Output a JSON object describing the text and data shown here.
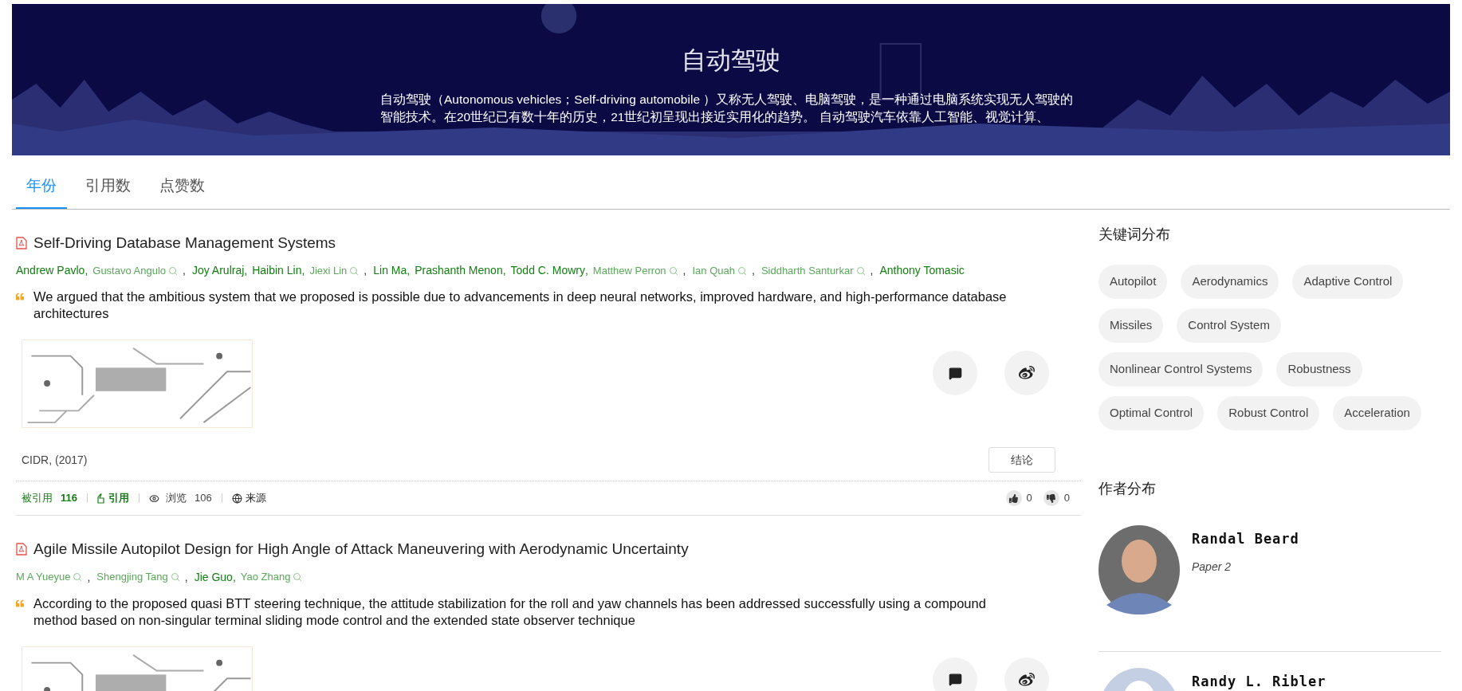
{
  "banner": {
    "title": "自动驾驶",
    "description": "自动驾驶（Autonomous vehicles；Self-driving automobile ）又称无人驾驶、电脑驾驶，是一种通过电脑系统实现无人驾驶的智能技术。在20世纪已有数十年的历史，21世纪初呈现出接近实用化的趋势。 自动驾驶汽车依靠人工智能、视觉计算、"
  },
  "tabs": [
    {
      "label": "年份",
      "selected": true
    },
    {
      "label": "引用数",
      "selected": false
    },
    {
      "label": "点赞数",
      "selected": false
    }
  ],
  "papers": [
    {
      "title": "Self-Driving Database Management Systems",
      "authors": [
        {
          "name": "Andrew Pavlo",
          "searchable": false,
          "separator": ","
        },
        {
          "name": "Gustavo Angulo",
          "searchable": true,
          "separator": ","
        },
        {
          "name": "Joy Arulraj",
          "searchable": false,
          "separator": ","
        },
        {
          "name": "Haibin Lin",
          "searchable": false,
          "separator": ","
        },
        {
          "name": "Jiexi Lin",
          "searchable": true,
          "separator": ","
        },
        {
          "name": "Lin Ma",
          "searchable": false,
          "separator": ","
        },
        {
          "name": "Prashanth Menon",
          "searchable": false,
          "separator": ","
        },
        {
          "name": "Todd C. Mowry",
          "searchable": false,
          "separator": ","
        },
        {
          "name": "Matthew Perron",
          "searchable": true,
          "separator": ","
        },
        {
          "name": "Ian Quah",
          "searchable": true,
          "separator": ","
        },
        {
          "name": "Siddharth Santurkar",
          "searchable": true,
          "separator": ","
        },
        {
          "name": "Anthony Tomasic",
          "searchable": false
        }
      ],
      "summary": "We argued that the ambitious system that we proposed is possible due to advancements in deep neural networks, improved hardware, and high-performance database architectures",
      "venue": "CIDR, (2017)",
      "conclusion_button": "结论",
      "stats": {
        "cited_label": "被引用",
        "cited_count": "116",
        "cite_label": "引用",
        "views_label": "浏览",
        "views_count": "106",
        "source_label": "来源",
        "likes": "0",
        "dislikes": "0"
      }
    },
    {
      "title": "Agile Missile Autopilot Design for High Angle of Attack Maneuvering with Aerodynamic Uncertainty",
      "authors": [
        {
          "name": "M A Yueyue",
          "searchable": true,
          "separator": ","
        },
        {
          "name": "Shengjing Tang",
          "searchable": true,
          "separator": ","
        },
        {
          "name": "Jie Guo",
          "searchable": false,
          "separator": ","
        },
        {
          "name": "Yao Zhang",
          "searchable": true
        }
      ],
      "summary": "According to the proposed quasi BTT steering technique, the attitude stabilization for the roll and yaw channels has been addressed successfully using a compound method based on non-singular terminal sliding mode control and the extended state observer technique"
    }
  ],
  "keywords": {
    "title": "关键词分布",
    "tags": [
      "Autopilot",
      "Aerodynamics",
      "Adaptive Control",
      "Missiles",
      "Control System",
      "Nonlinear Control Systems",
      "Robustness",
      "Optimal Control",
      "Robust Control",
      "Acceleration"
    ]
  },
  "author_distribution": {
    "title": "作者分布",
    "authors": [
      {
        "name": "Randal Beard",
        "papers": "Paper 2"
      },
      {
        "name": "Randy L. Ribler",
        "kind": "default"
      }
    ]
  }
}
